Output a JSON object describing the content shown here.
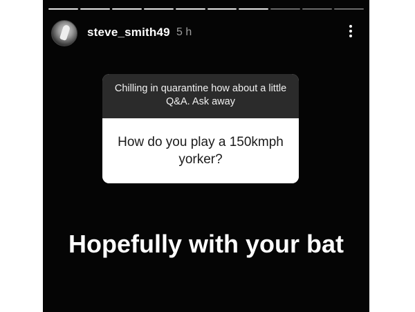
{
  "story": {
    "progress": {
      "segments_done": 7,
      "segments_total": 10
    },
    "user": {
      "username": "steve_smith49",
      "time_ago": "5 h"
    },
    "question_box": {
      "prompt": "Chilling in quarantine how about a little Q&A. Ask away",
      "question": "How do you play a 150kmph yorker?"
    },
    "answer_text": "Hopefully with your bat"
  },
  "icons": {
    "more": "more-vertical-icon",
    "avatar": "avatar"
  },
  "colors": {
    "story_background": "#050505",
    "prompt_background": "#2b2b2b",
    "question_background": "#ffffff",
    "progress_done": "#e6e6e6",
    "progress_todo": "#6b6b6b"
  }
}
